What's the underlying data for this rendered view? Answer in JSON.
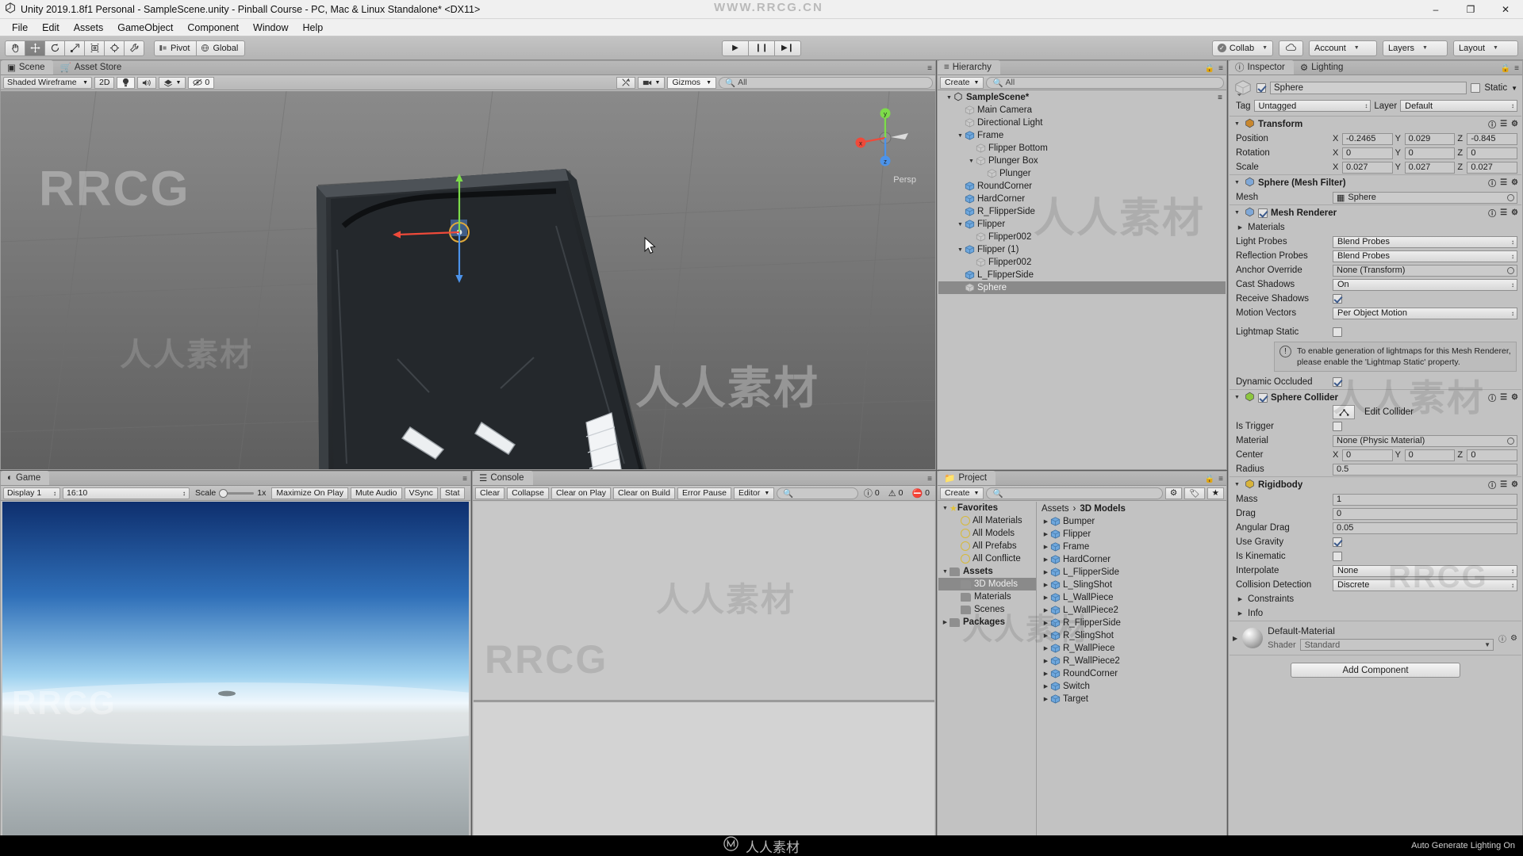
{
  "window": {
    "title": "Unity 2019.1.8f1 Personal - SampleScene.unity - Pinball Course - PC, Mac & Linux Standalone* <DX11>",
    "minimize": "–",
    "maximize": "❐",
    "close": "✕"
  },
  "menu": [
    "File",
    "Edit",
    "Assets",
    "GameObject",
    "Component",
    "Window",
    "Help"
  ],
  "toolbar": {
    "tools": [
      "hand-tool",
      "move-tool",
      "rotate-tool",
      "scale-tool",
      "rect-tool",
      "transform-tool",
      "custom-tool"
    ],
    "pivot_label": "Pivot",
    "global_label": "Global",
    "play": "▶",
    "pause": "❙❙",
    "step": "▶❙",
    "collab_label": "Collab",
    "cloud_label": "☁",
    "account_label": "Account",
    "layers_label": "Layers",
    "layout_label": "Layout"
  },
  "scene": {
    "tabs": [
      {
        "label": "Scene",
        "selected": true
      },
      {
        "label": "Asset Store",
        "selected": false
      }
    ],
    "draw_mode": "Shaded Wireframe",
    "mode_2d": "2D",
    "audio_count": "0",
    "gizmos_label": "Gizmos",
    "search_placeholder": "All",
    "persp_label": "Persp",
    "axis_x": "x",
    "axis_y": "y",
    "axis_z": "z"
  },
  "game": {
    "tab": "Game",
    "display": "Display 1",
    "aspect": "16:10",
    "scale_label": "Scale",
    "scale_value": "1x",
    "maximize": "Maximize On Play",
    "mute": "Mute Audio",
    "vsync": "VSync",
    "stats": "Stat"
  },
  "console": {
    "tab": "Console",
    "buttons": [
      "Clear",
      "Collapse",
      "Clear on Play",
      "Clear on Build",
      "Error Pause"
    ],
    "editor_label": "Editor",
    "counts": {
      "info": "0",
      "warning": "0",
      "error": "0"
    }
  },
  "hierarchy": {
    "tab": "Hierarchy",
    "create_label": "Create",
    "search_placeholder": "All",
    "scene_name": "SampleScene*",
    "items": [
      {
        "label": "Main Camera",
        "depth": 1,
        "arrow": "",
        "icon": "gameobject",
        "selected": false
      },
      {
        "label": "Directional Light",
        "depth": 1,
        "arrow": "",
        "icon": "gameobject",
        "selected": false
      },
      {
        "label": "Frame",
        "depth": 1,
        "arrow": "▼",
        "icon": "prefab",
        "selected": false
      },
      {
        "label": "Flipper Bottom",
        "depth": 2,
        "arrow": "",
        "icon": "gameobject",
        "selected": false
      },
      {
        "label": "Plunger Box",
        "depth": 2,
        "arrow": "▼",
        "icon": "gameobject",
        "selected": false
      },
      {
        "label": "Plunger",
        "depth": 3,
        "arrow": "",
        "icon": "gameobject",
        "selected": false
      },
      {
        "label": "RoundCorner",
        "depth": 1,
        "arrow": "",
        "icon": "prefab",
        "selected": false
      },
      {
        "label": "HardCorner",
        "depth": 1,
        "arrow": "",
        "icon": "prefab",
        "selected": false
      },
      {
        "label": "R_FlipperSide",
        "depth": 1,
        "arrow": "",
        "icon": "prefab",
        "selected": false
      },
      {
        "label": "Flipper",
        "depth": 1,
        "arrow": "▼",
        "icon": "prefab",
        "selected": false
      },
      {
        "label": "Flipper002",
        "depth": 2,
        "arrow": "",
        "icon": "gameobject",
        "selected": false
      },
      {
        "label": "Flipper (1)",
        "depth": 1,
        "arrow": "▼",
        "icon": "prefab",
        "selected": false
      },
      {
        "label": "Flipper002",
        "depth": 2,
        "arrow": "",
        "icon": "gameobject",
        "selected": false
      },
      {
        "label": "L_FlipperSide",
        "depth": 1,
        "arrow": "",
        "icon": "prefab",
        "selected": false
      },
      {
        "label": "Sphere",
        "depth": 1,
        "arrow": "",
        "icon": "gameobject",
        "selected": true
      }
    ]
  },
  "project": {
    "tab": "Project",
    "create_label": "Create",
    "search_placeholder": "",
    "tree": [
      {
        "label": "Favorites",
        "depth": 0,
        "arrow": "▼",
        "icon": "star",
        "bold": true,
        "selected": false
      },
      {
        "label": "All Materials",
        "depth": 1,
        "arrow": "",
        "icon": "search",
        "bold": false,
        "selected": false
      },
      {
        "label": "All Models",
        "depth": 1,
        "arrow": "",
        "icon": "search",
        "bold": false,
        "selected": false
      },
      {
        "label": "All Prefabs",
        "depth": 1,
        "arrow": "",
        "icon": "search",
        "bold": false,
        "selected": false
      },
      {
        "label": "All Conflicte",
        "depth": 1,
        "arrow": "",
        "icon": "search",
        "bold": false,
        "selected": false
      },
      {
        "label": "Assets",
        "depth": 0,
        "arrow": "▼",
        "icon": "folder",
        "bold": true,
        "selected": false
      },
      {
        "label": "3D Models",
        "depth": 1,
        "arrow": "",
        "icon": "folder",
        "bold": false,
        "selected": true
      },
      {
        "label": "Materials",
        "depth": 1,
        "arrow": "",
        "icon": "folder",
        "bold": false,
        "selected": false
      },
      {
        "label": "Scenes",
        "depth": 1,
        "arrow": "",
        "icon": "folder",
        "bold": false,
        "selected": false
      },
      {
        "label": "Packages",
        "depth": 0,
        "arrow": "▶",
        "icon": "folder",
        "bold": true,
        "selected": false
      }
    ],
    "breadcrumb": [
      "Assets",
      "3D Models"
    ],
    "assets": [
      "Bumper",
      "Flipper",
      "Frame",
      "HardCorner",
      "L_FlipperSide",
      "L_SlingShot",
      "L_WallPiece",
      "L_WallPiece2",
      "R_FlipperSide",
      "R_SlingShot",
      "R_WallPiece",
      "R_WallPiece2",
      "RoundCorner",
      "Switch",
      "Target"
    ]
  },
  "inspector": {
    "tabs": [
      {
        "label": "Inspector",
        "selected": true
      },
      {
        "label": "Lighting",
        "selected": false
      }
    ],
    "object_name": "Sphere",
    "static_label": "Static",
    "tag_label": "Tag",
    "tag_value": "Untagged",
    "layer_label": "Layer",
    "layer_value": "Default",
    "components": [
      {
        "name": "Transform",
        "icon_color": "#c8872e",
        "rows": [
          {
            "label": "Position",
            "type": "vec3",
            "x": "-0.2465",
            "y": "0.029",
            "z": "-0.845"
          },
          {
            "label": "Rotation",
            "type": "vec3",
            "x": "0",
            "y": "0",
            "z": "0"
          },
          {
            "label": "Scale",
            "type": "vec3",
            "x": "0.027",
            "y": "0.027",
            "z": "0.027"
          }
        ]
      },
      {
        "name": "Sphere (Mesh Filter)",
        "icon_color": "#7fa8d8",
        "rows": [
          {
            "label": "Mesh",
            "type": "object",
            "value": "Sphere"
          }
        ]
      },
      {
        "name": "Mesh Renderer",
        "icon_color": "#7fa8d8",
        "enabled": true,
        "rows": [
          {
            "label": "Materials",
            "type": "foldout"
          },
          {
            "label": "Light Probes",
            "type": "combo",
            "value": "Blend Probes"
          },
          {
            "label": "Reflection Probes",
            "type": "combo",
            "value": "Blend Probes"
          },
          {
            "label": "Anchor Override",
            "type": "object",
            "value": "None (Transform)"
          },
          {
            "label": "Cast Shadows",
            "type": "combo",
            "value": "On"
          },
          {
            "label": "Receive Shadows",
            "type": "check",
            "value": true
          },
          {
            "label": "Motion Vectors",
            "type": "combo",
            "value": "Per Object Motion"
          },
          {
            "label": "",
            "type": "gap"
          },
          {
            "label": "Lightmap Static",
            "type": "check",
            "value": false
          },
          {
            "label": "",
            "type": "info",
            "value": "To enable generation of lightmaps for this Mesh Renderer, please enable the 'Lightmap Static' property."
          },
          {
            "label": "Dynamic Occluded",
            "type": "check",
            "value": true
          }
        ]
      },
      {
        "name": "Sphere Collider",
        "icon_color": "#8dc63f",
        "enabled": true,
        "rows": [
          {
            "label": "",
            "type": "editcollider",
            "value": "Edit Collider"
          },
          {
            "label": "Is Trigger",
            "type": "check",
            "value": false
          },
          {
            "label": "Material",
            "type": "object",
            "value": "None (Physic Material)"
          },
          {
            "label": "Center",
            "type": "vec3",
            "x": "0",
            "y": "0",
            "z": "0"
          },
          {
            "label": "Radius",
            "type": "field",
            "value": "0.5"
          }
        ]
      },
      {
        "name": "Rigidbody",
        "icon_color": "#d8b33a",
        "rows": [
          {
            "label": "Mass",
            "type": "field",
            "value": "1"
          },
          {
            "label": "Drag",
            "type": "field",
            "value": "0"
          },
          {
            "label": "Angular Drag",
            "type": "field",
            "value": "0.05"
          },
          {
            "label": "Use Gravity",
            "type": "check",
            "value": true
          },
          {
            "label": "Is Kinematic",
            "type": "check",
            "value": false
          },
          {
            "label": "Interpolate",
            "type": "combo",
            "value": "None"
          },
          {
            "label": "Collision Detection",
            "type": "combo",
            "value": "Discrete"
          },
          {
            "label": "Constraints",
            "type": "foldout"
          },
          {
            "label": "Info",
            "type": "foldout"
          }
        ]
      }
    ],
    "material": {
      "name": "Default-Material",
      "shader_label": "Shader",
      "shader_value": "Standard"
    },
    "add_component": "Add Component"
  },
  "statusbar": {
    "right_text": "Auto Generate Lighting On",
    "brand": "人人素材"
  },
  "watermarks": {
    "top": "WWW.RRCG.CN",
    "big1": "RRCG",
    "big2": "人人素材"
  },
  "colors": {
    "accent_blue": "#3c5a8c",
    "panel_bg": "#c2c2c2",
    "toolbar_bg": "#b4b4b4",
    "selection": "#8a8a8a",
    "scene_bg": "#6f6f6f"
  }
}
